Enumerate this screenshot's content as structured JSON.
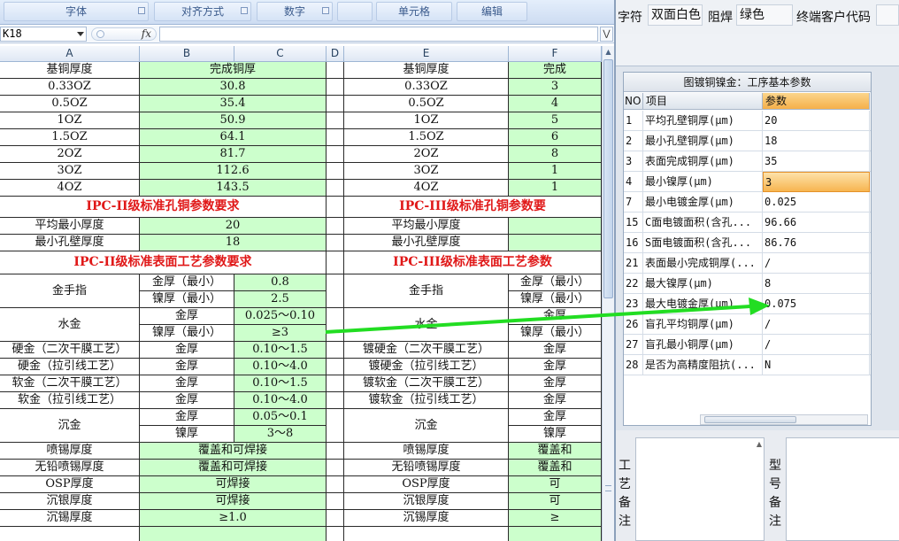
{
  "excel": {
    "ribbon": [
      "字体",
      "对齐方式",
      "数字",
      "",
      "单元格",
      "编辑"
    ],
    "namebox": "K18",
    "fx": "fx",
    "col_headers": [
      "A",
      "B",
      "C",
      "D",
      "E",
      "F"
    ],
    "rows": [
      {
        "a": "基铜厚度",
        "bc": "完成铜厚",
        "e": "基铜厚度",
        "f": "完成"
      },
      {
        "a": "0.33OZ",
        "bc": "30.8",
        "e": "0.33OZ",
        "f": "3"
      },
      {
        "a": "0.5OZ",
        "bc": "35.4",
        "e": "0.5OZ",
        "f": "4"
      },
      {
        "a": "1OZ",
        "bc": "50.9",
        "e": "1OZ",
        "f": "5"
      },
      {
        "a": "1.5OZ",
        "bc": "64.1",
        "e": "1.5OZ",
        "f": "6"
      },
      {
        "a": "2OZ",
        "bc": "81.7",
        "e": "2OZ",
        "f": "8"
      },
      {
        "a": "3OZ",
        "bc": "112.6",
        "e": "3OZ",
        "f": "1"
      },
      {
        "a": "4OZ",
        "bc": "143.5",
        "e": "4OZ",
        "f": "1"
      }
    ],
    "ipc2_hole_title": "IPC-II级标准孔铜参数要求",
    "ipc3_hole_title": "IPC-III级标准孔铜参数要",
    "hole_rows": [
      {
        "a": "平均最小厚度",
        "bc": "20",
        "e": "平均最小厚度"
      },
      {
        "a": "最小孔壁厚度",
        "bc": "18",
        "e": "最小孔壁厚度"
      }
    ],
    "ipc2_surface_title": "IPC-II级标准表面工艺参数要求",
    "ipc3_surface_title": "IPC-III级标准表面工艺参数",
    "gold_finger": {
      "label": "金手指",
      "r1b": "金厚（最小）",
      "r1c": "0.8",
      "r2b": "镍厚（最小）",
      "r2c": "2.5"
    },
    "water_gold": {
      "label": "水金",
      "r1b": "金厚",
      "r1c": "0.025～0.10",
      "r2b": "镍厚（最小）",
      "r2c": "≥3"
    },
    "plating": [
      {
        "a": "硬金（二次干膜工艺）",
        "b": "金厚",
        "c": "0.10～1.5",
        "e": "镀硬金（二次干膜工艺）",
        "f": "金厚"
      },
      {
        "a": "硬金（拉引线工艺）",
        "b": "金厚",
        "c": "0.10～4.0",
        "e": "镀硬金（拉引线工艺）",
        "f": "金厚"
      },
      {
        "a": "软金（二次干膜工艺）",
        "b": "金厚",
        "c": "0.10～1.5",
        "e": "镀软金（二次干膜工艺）",
        "f": "金厚"
      },
      {
        "a": "软金（拉引线工艺）",
        "b": "金厚",
        "c": "0.10～4.0",
        "e": "镀软金（拉引线工艺）",
        "f": "金厚"
      }
    ],
    "immersion_gold": {
      "label": "沉金",
      "r1b": "金厚",
      "r1c": "0.05～0.1",
      "r2b": "镍厚",
      "r2c": "3～8"
    },
    "finish_rows": [
      {
        "a": "喷锡厚度",
        "bc": "覆盖和可焊接",
        "e": "喷锡厚度",
        "f": "覆盖和"
      },
      {
        "a": "无铅喷锡厚度",
        "bc": "覆盖和可焊接",
        "e": "无铅喷锡厚度",
        "f": "覆盖和"
      },
      {
        "a": "OSP厚度",
        "bc": "可焊接",
        "e": "OSP厚度",
        "f": "可"
      },
      {
        "a": "沉银厚度",
        "bc": "可焊接",
        "e": "沉银厚度",
        "f": "可"
      },
      {
        "a": "沉锡厚度",
        "bc": "≥1.0",
        "e": "沉锡厚度",
        "f": "≥"
      }
    ]
  },
  "app": {
    "top": {
      "char_label": "字符",
      "char_value": "双面白色",
      "mask_label": "阻焊",
      "mask_value": "绿色",
      "customer_label": "终端客户代码",
      "customer_value": ""
    },
    "grid_title": "图镀铜镍金：工序基本参数",
    "headers": {
      "no": "NO",
      "item": "项目",
      "param": "参数"
    },
    "rows": [
      {
        "no": "1",
        "item": "平均孔壁铜厚(μm)",
        "val": "20"
      },
      {
        "no": "2",
        "item": "最小孔壁铜厚(μm)",
        "val": "18"
      },
      {
        "no": "3",
        "item": "表面完成铜厚(μm)",
        "val": "35"
      },
      {
        "no": "4",
        "item": "最小镍厚(μm)",
        "val": "3",
        "selected": true
      },
      {
        "no": "7",
        "item": "最小电镀金厚(μm)",
        "val": "0.025"
      },
      {
        "no": "15",
        "item": "C面电镀面积(含孔...",
        "val": "96.66"
      },
      {
        "no": "16",
        "item": "S面电镀面积(含孔...",
        "val": "86.76"
      },
      {
        "no": "21",
        "item": "表面最小完成铜厚(...",
        "val": "/"
      },
      {
        "no": "22",
        "item": "最大镍厚(μm)",
        "val": "8"
      },
      {
        "no": "23",
        "item": "最大电镀金厚(μm)",
        "val": "0.075"
      },
      {
        "no": "26",
        "item": "盲孔平均铜厚(μm)",
        "val": "/"
      },
      {
        "no": "27",
        "item": "盲孔最小铜厚(μm)",
        "val": "/"
      },
      {
        "no": "28",
        "item": "是否为高精度阻抗(...",
        "val": "N"
      }
    ],
    "bottom": {
      "process_note": "工\n艺\n备\n注",
      "model_note": "型\n号\n备\n注"
    }
  },
  "colors": {
    "green_cell": "#ccffcc",
    "ipc_title": "#e01818",
    "arrow": "#22dd22",
    "selected": "#f7b550"
  }
}
